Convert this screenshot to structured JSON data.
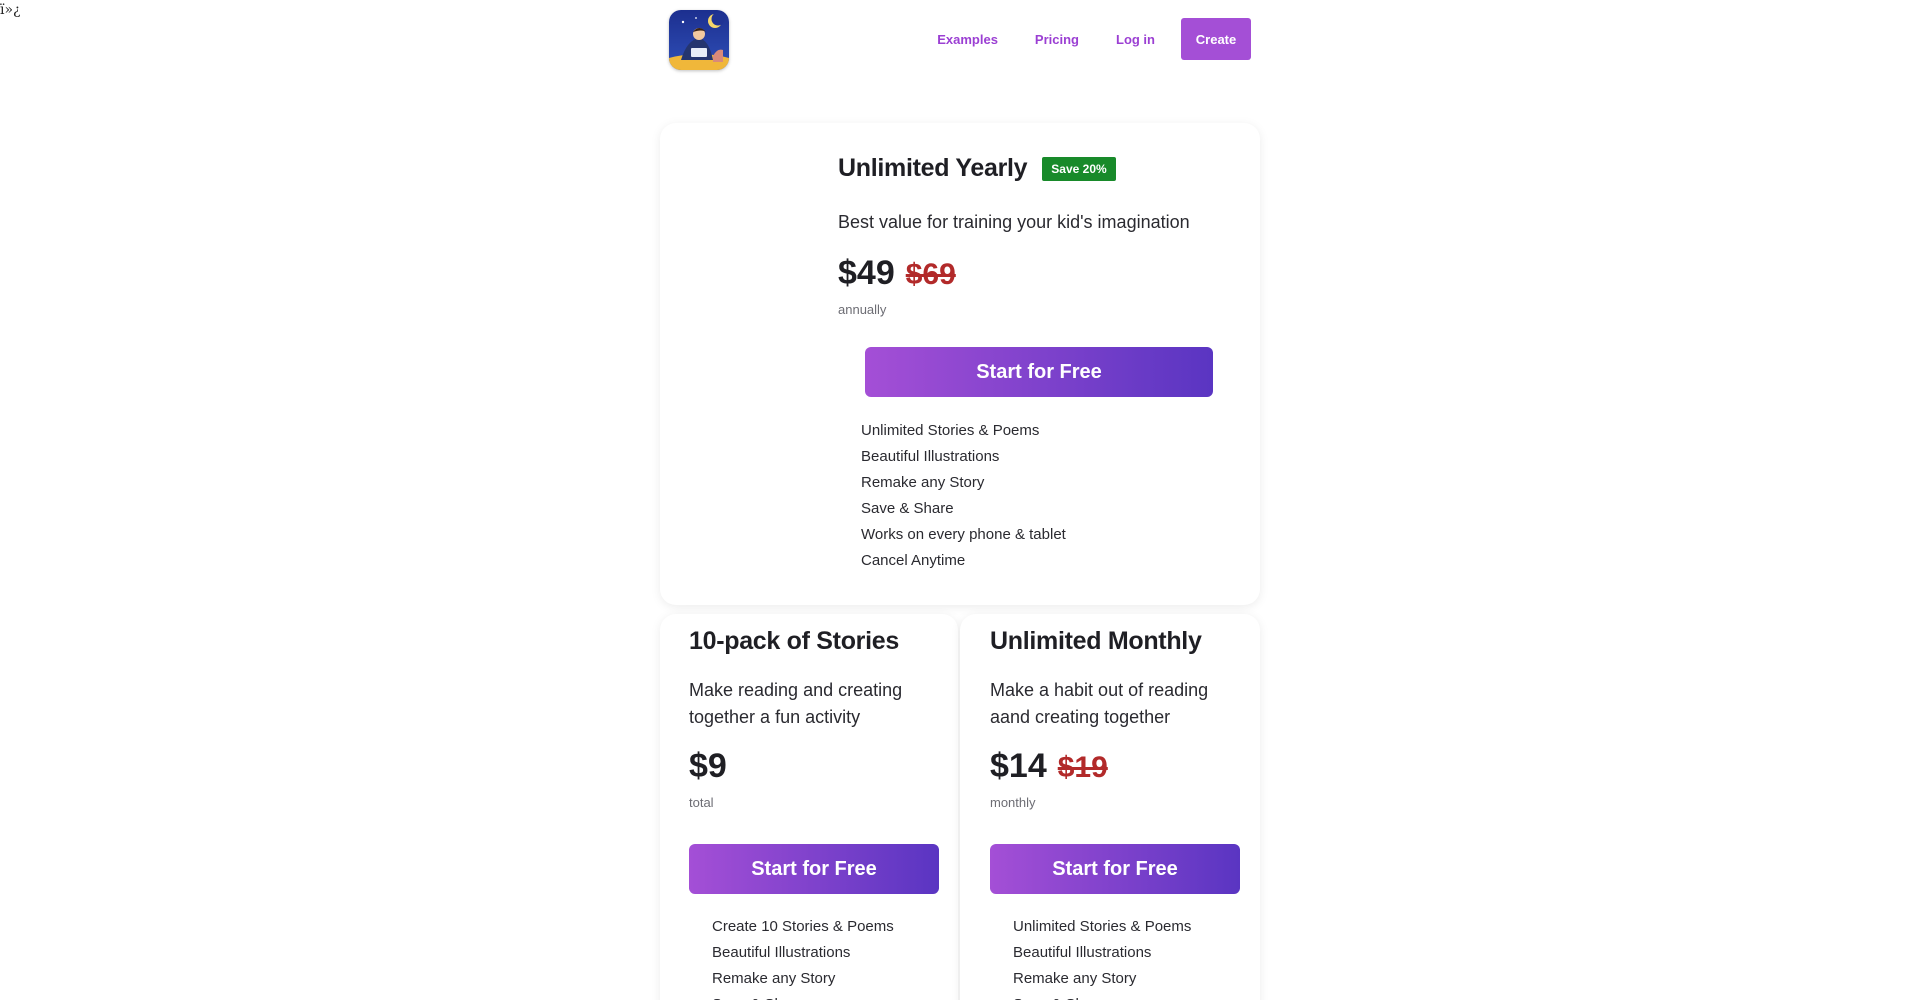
{
  "page": {
    "stray_text": "ï»¿"
  },
  "header": {
    "nav": {
      "examples": "Examples",
      "pricing": "Pricing",
      "login": "Log in",
      "create": "Create"
    }
  },
  "plans": {
    "yearly": {
      "title": "Unlimited Yearly",
      "badge": "Save 20%",
      "description": "Best value for training your kid's imagination",
      "price": "$49",
      "old_price": "$69",
      "period": "annually",
      "cta": "Start for Free",
      "features": [
        "Unlimited Stories & Poems",
        "Beautiful Illustrations",
        "Remake any Story",
        "Save & Share",
        "Works on every phone & tablet",
        "Cancel Anytime"
      ]
    },
    "pack": {
      "title": "10-pack of Stories",
      "description": "Make reading and creating together a fun activity",
      "price": "$9",
      "period": "total",
      "cta": "Start for Free",
      "features": [
        "Create 10 Stories & Poems",
        "Beautiful Illustrations",
        "Remake any Story",
        "Save & Share"
      ]
    },
    "monthly": {
      "title": "Unlimited Monthly",
      "description": "Make a habit out of reading aand creating together",
      "price": "$14",
      "old_price": "$19",
      "period": "monthly",
      "cta": "Start for Free",
      "features": [
        "Unlimited Stories & Poems",
        "Beautiful Illustrations",
        "Remake any Story",
        "Save & Share"
      ]
    }
  },
  "colors": {
    "accent": "#a44fd6",
    "gradient_end": "#5a35c2",
    "badge": "#188a2a",
    "strike": "#b22a2a"
  },
  "icons": {
    "logo": "bedtime-story-logo-icon"
  }
}
